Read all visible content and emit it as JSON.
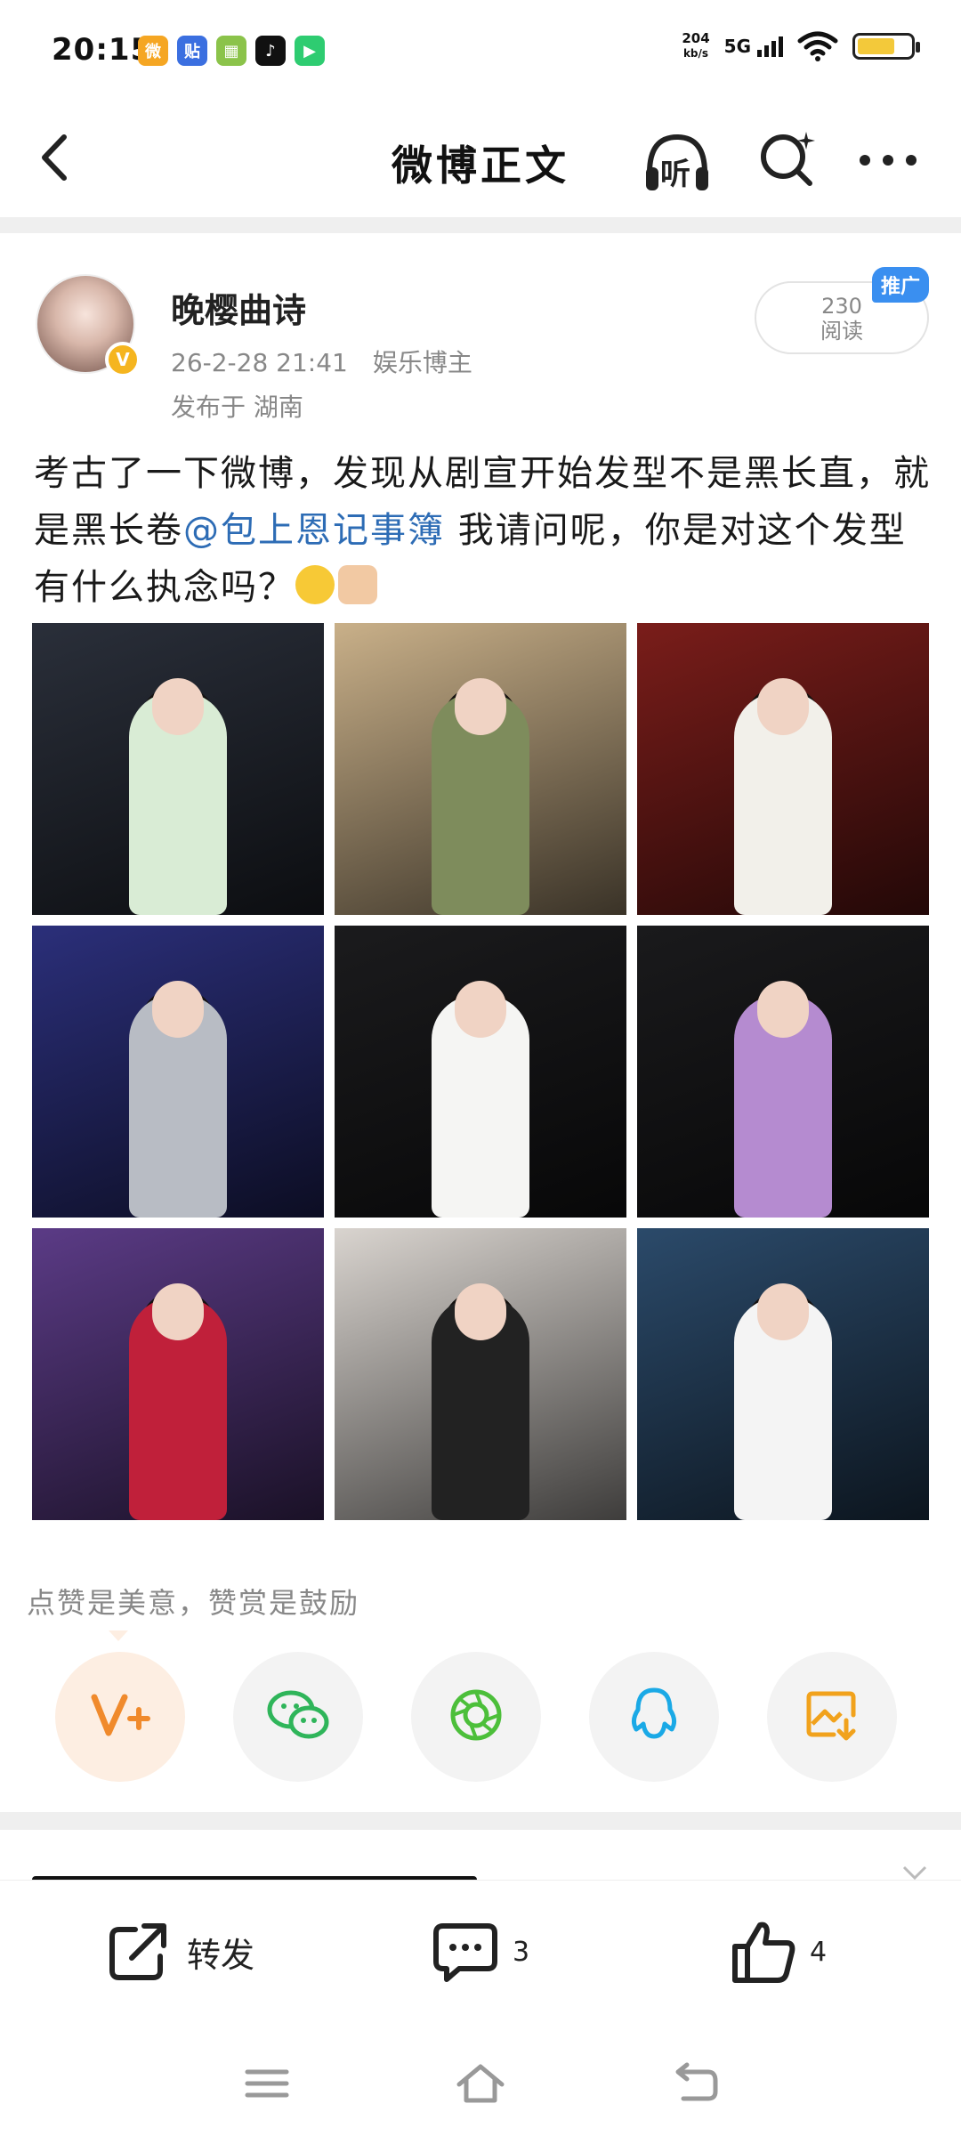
{
  "status_bar": {
    "time": "20:15",
    "app_icons": [
      {
        "name": "weibo-icon",
        "color": "#f5a623",
        "glyph": "微"
      },
      {
        "name": "tieba-icon",
        "color": "#3b6fe0",
        "glyph": "贴"
      },
      {
        "name": "calendar-icon",
        "color": "#8bc34a",
        "glyph": "▦"
      },
      {
        "name": "tiktok-icon",
        "color": "#111111",
        "glyph": "♪"
      },
      {
        "name": "video-play-icon",
        "color": "#2ecc71",
        "glyph": "▶"
      }
    ],
    "net_speed": "204",
    "net_speed_unit": "kb/s",
    "network": "5G",
    "battery_color": "#f3c93a"
  },
  "nav": {
    "title": "微博正文",
    "listen_label": "听"
  },
  "author": {
    "name": "晚樱曲诗",
    "date": "26-2-28 21:41",
    "tag": "娱乐博主",
    "location": "发布于 湖南",
    "verified_mark": "V"
  },
  "reads": {
    "count": "230",
    "label": "阅读",
    "promo": "推广"
  },
  "post": {
    "text_before": "考古了一下微博，发现从剧宣开始发型不是黑长直，就是黑长卷",
    "mention": "@包上恩记事簿",
    "text_after": " 我请问呢，你是对这个发型有什么执念吗？"
  },
  "photos": [
    {
      "bg": "#2a2f3a",
      "accent": "#d9ecd5"
    },
    {
      "bg": "#c9b089",
      "accent": "#7e8c5c"
    },
    {
      "bg": "#7a1d1a",
      "accent": "#f2f0ea"
    },
    {
      "bg": "#2b2f7a",
      "accent": "#b8bcc4"
    },
    {
      "bg": "#1b1b1d",
      "accent": "#f5f5f3"
    },
    {
      "bg": "#1a1a1c",
      "accent": "#b58bd0"
    },
    {
      "bg": "#5b3b86",
      "accent": "#c0203a"
    },
    {
      "bg": "#d9d4cf",
      "accent": "#222222"
    },
    {
      "bg": "#2b4a6a",
      "accent": "#f4f4f4"
    }
  ],
  "like_hint": "点赞是美意，赞赏是鼓励",
  "share": [
    {
      "name": "reward-vplus-icon",
      "bg": "#fdeee2",
      "color": "#f08a2c"
    },
    {
      "name": "wechat-icon",
      "bg": "#f3f3f3",
      "color": "#2fb55a"
    },
    {
      "name": "moments-icon",
      "bg": "#f3f3f3",
      "color": "#4cbf3a"
    },
    {
      "name": "qq-icon",
      "bg": "#f3f3f3",
      "color": "#1aa9e6"
    },
    {
      "name": "save-image-icon",
      "bg": "#f3f3f3",
      "color": "#f1a21c"
    }
  ],
  "actions": {
    "repost_label": "转发",
    "comments_count": "3",
    "likes_count": "4"
  }
}
